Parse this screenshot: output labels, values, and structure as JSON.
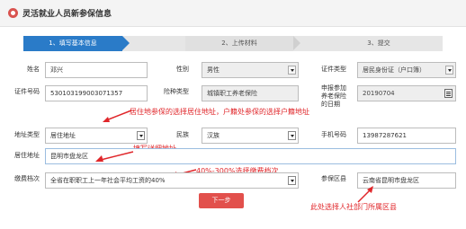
{
  "header": {
    "title": "灵活就业人员新参保信息"
  },
  "steps": [
    {
      "label": "1、填写基本信息"
    },
    {
      "label": "2、上传材料"
    },
    {
      "label": "3、提交"
    }
  ],
  "form": {
    "name": {
      "label": "姓名",
      "value": "邓兴"
    },
    "gender": {
      "label": "性别",
      "value": "男性"
    },
    "id_type": {
      "label": "证件类型",
      "value": "居民身份证（户口簿）"
    },
    "id_number": {
      "label": "证件号码",
      "value": "530103199003071357"
    },
    "insurance_type": {
      "label": "险种类型",
      "value": "城镇职工养老保险"
    },
    "apply_date": {
      "label": "申报参加养老保险的日期",
      "value": "20190704"
    },
    "address_type": {
      "label": "地址类型",
      "value": "居住地址"
    },
    "ethnicity": {
      "label": "民族",
      "value": "汉族"
    },
    "phone": {
      "label": "手机号码",
      "value": "13987287621"
    },
    "address": {
      "label": "居住地址",
      "value": "昆明市盘龙区"
    },
    "contribution_level": {
      "label": "缴费档次",
      "value": "全省在职职工上一年社会平均工资的40%"
    },
    "insured_area": {
      "label": "参保区县",
      "value": "云南省昆明市盘龙区"
    }
  },
  "annotations": {
    "address_note": "居住地参保的选择居住地址，户籍处参保的选择户籍地址",
    "detail_note": "填写详细地址",
    "level_note": "40%-300%选择缴费档次",
    "area_note": "此处选择人社部门所属区县"
  },
  "buttons": {
    "next": "下一步"
  },
  "colors": {
    "accent": "#2a7bc8",
    "annotation": "#e0262a",
    "next_button": "#e2504c"
  }
}
